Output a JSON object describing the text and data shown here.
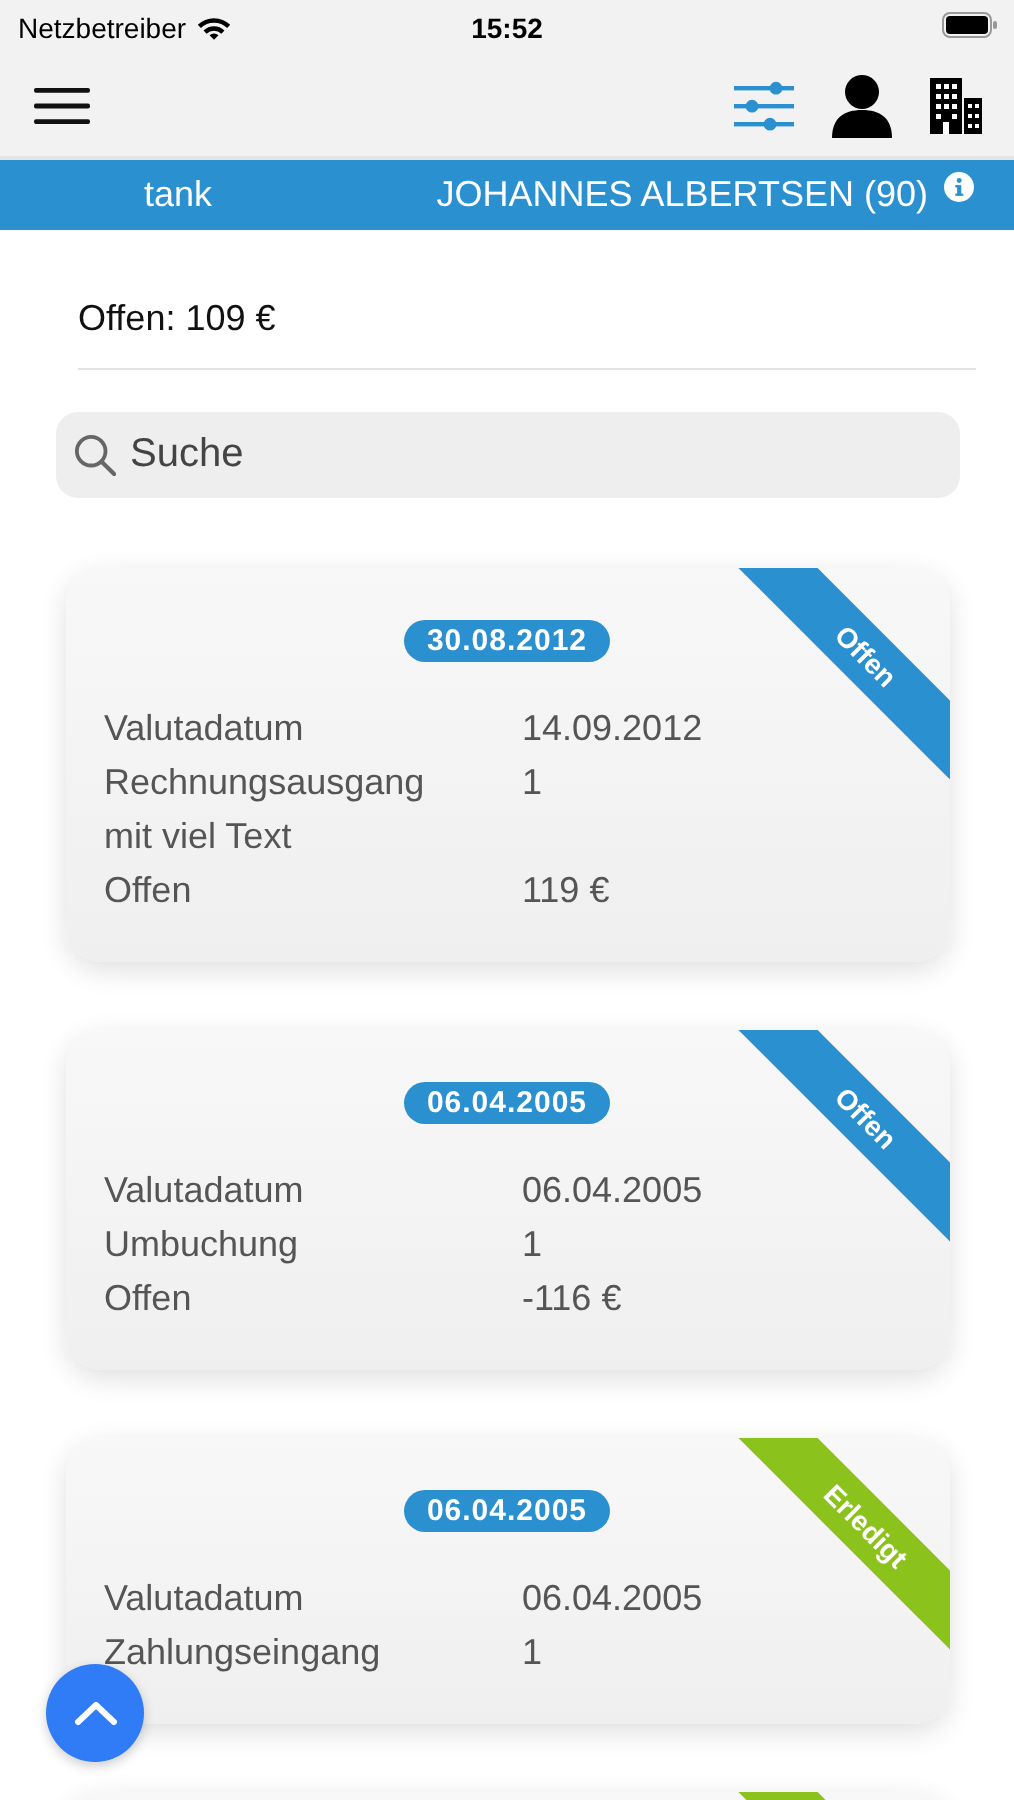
{
  "status_bar": {
    "carrier": "Netzbetreiber",
    "time": "15:52"
  },
  "context_bar": {
    "left": "tank",
    "right": "JOHANNES ALBERTSEN (90)"
  },
  "summary": "Offen: 109 €",
  "search": {
    "placeholder": "Suche"
  },
  "cards": [
    {
      "date": "30.08.2012",
      "status": {
        "label": "Offen",
        "kind": "open"
      },
      "fields": [
        {
          "label": "Valutadatum",
          "value": "14.09.2012"
        },
        {
          "label": "Rechnungsausgang mit viel Text",
          "value": "1"
        },
        {
          "label": "Offen",
          "value": "119 €"
        }
      ]
    },
    {
      "date": "06.04.2005",
      "status": {
        "label": "Offen",
        "kind": "open"
      },
      "fields": [
        {
          "label": "Valutadatum",
          "value": "06.04.2005"
        },
        {
          "label": "Umbuchung",
          "value": "1"
        },
        {
          "label": "Offen",
          "value": "-116 €"
        }
      ]
    },
    {
      "date": "06.04.2005",
      "status": {
        "label": "Erledigt",
        "kind": "done"
      },
      "fields": [
        {
          "label": "Valutadatum",
          "value": "06.04.2005"
        },
        {
          "label": "Zahlungseingang",
          "value": "1"
        }
      ]
    },
    {
      "status": {
        "kind": "done"
      }
    }
  ]
}
